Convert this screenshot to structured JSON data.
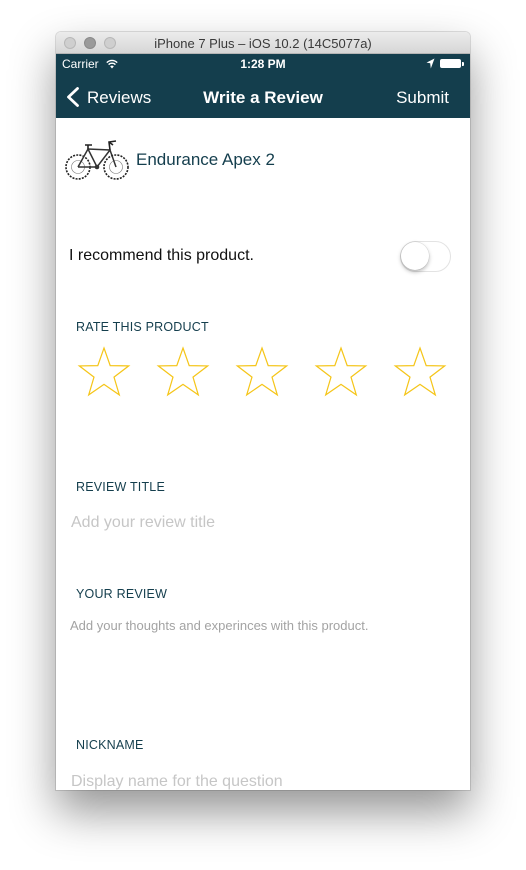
{
  "window": {
    "title": "iPhone 7 Plus – iOS 10.2 (14C5077a)"
  },
  "status_bar": {
    "carrier": "Carrier",
    "time": "1:28 PM",
    "icons": [
      "wifi-icon",
      "location-arrow-icon",
      "battery-icon"
    ]
  },
  "nav": {
    "back_label": "Reviews",
    "title": "Write a Review",
    "submit_label": "Submit",
    "color": "#143e4d"
  },
  "product": {
    "name": "Endurance Apex 2",
    "image_icon": "bicycle-icon"
  },
  "recommend": {
    "label": "I recommend this product.",
    "toggle_on": false
  },
  "rating": {
    "label": "RATE THIS PRODUCT",
    "stars_total": 5,
    "stars_selected": 0,
    "star_color": "#f5c518"
  },
  "review_title": {
    "label": "REVIEW TITLE",
    "placeholder": "Add your review title"
  },
  "review_body": {
    "label": "YOUR REVIEW",
    "placeholder": "Add your thoughts and experinces with this product."
  },
  "nickname": {
    "label": "NICKNAME",
    "placeholder": "Display name for the question"
  }
}
